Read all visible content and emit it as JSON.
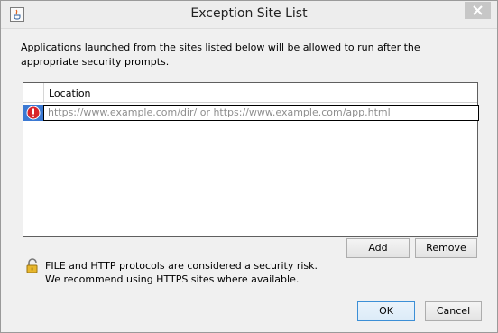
{
  "window": {
    "title": "Exception Site List"
  },
  "description": "Applications launched from the sites listed below will be allowed to run after the appropriate security prompts.",
  "table": {
    "columns": [
      "Location"
    ],
    "rows": [
      {
        "placeholder": "https://www.example.com/dir/ or https://www.example.com/app.html",
        "status_icon": "error-icon"
      }
    ]
  },
  "buttons": {
    "add": "Add",
    "remove": "Remove",
    "ok": "OK",
    "cancel": "Cancel"
  },
  "warning": {
    "line1": "FILE and HTTP protocols are considered a security risk.",
    "line2": "We recommend using HTTPS sites where available.",
    "icon": "lock-icon"
  },
  "colors": {
    "selection": "#3b79d3",
    "error_red": "#d8232a",
    "default_button_border": "#3c8fd6"
  }
}
